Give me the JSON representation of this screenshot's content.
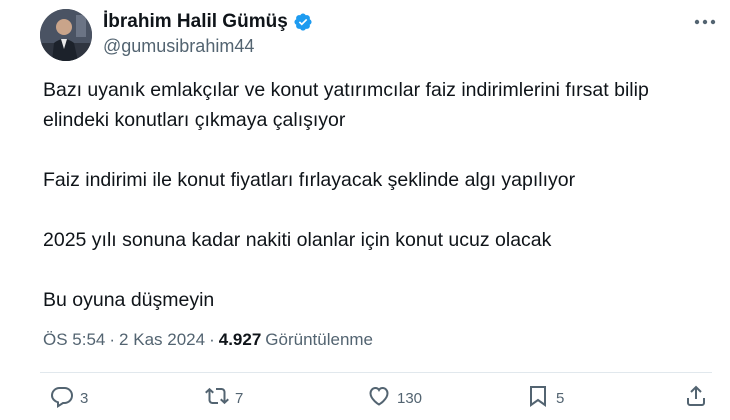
{
  "author": {
    "display_name": "İbrahim Halil Gümüş",
    "handle": "@gumusibrahim44",
    "verified": true
  },
  "tweet": {
    "paragraphs": [
      "Bazı uyanık emlakçılar ve konut yatırımcılar faiz indirimlerini fırsat bilip elindeki konutları çıkmaya çalışıyor",
      "Faiz indirimi ile konut fiyatları fırlayacak şeklinde algı yapılıyor",
      "2025 yılı sonuna kadar nakiti olanlar için konut ucuz olacak",
      "Bu oyuna düşmeyin"
    ],
    "time": "ÖS 5:54",
    "separator": "·",
    "date": "2 Kas 2024",
    "views_count": "4.927",
    "views_label": "Görüntülenme"
  },
  "actions": {
    "replies": "3",
    "retweets": "7",
    "likes": "130",
    "bookmarks": "5"
  },
  "colors": {
    "text": "#0f1419",
    "secondary": "#536471",
    "verified": "#1d9bf0",
    "divider": "#e1e8ed"
  },
  "icons": [
    "avatar",
    "verified-badge-icon",
    "more-options-icon",
    "reply-icon",
    "retweet-icon",
    "like-icon",
    "bookmark-icon",
    "share-icon"
  ]
}
